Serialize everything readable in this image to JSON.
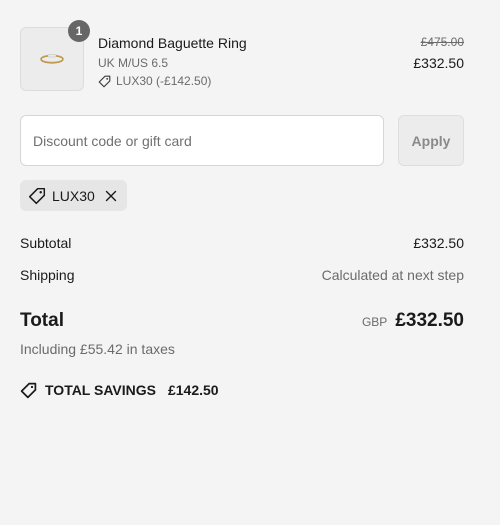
{
  "line_item": {
    "quantity": "1",
    "title": "Diamond Baguette Ring",
    "variant": "UK M/US 6.5",
    "discount": "LUX30 (-£142.50)",
    "original_price": "£475.00",
    "price": "£332.50",
    "thumbnail_icon": "ring-icon"
  },
  "discount": {
    "placeholder": "Discount code or gift card",
    "value": "",
    "apply_label": "Apply",
    "applied_code": "LUX30"
  },
  "summary": {
    "subtotal_label": "Subtotal",
    "subtotal_value": "£332.50",
    "shipping_label": "Shipping",
    "shipping_value": "Calculated at next step",
    "total_label": "Total",
    "currency": "GBP",
    "total_value": "£332.50",
    "tax_note": "Including £55.42 in taxes",
    "savings_label": "TOTAL SAVINGS",
    "savings_value": "£142.50"
  },
  "colors": {
    "background": "#f4f4f4",
    "badge": "#666666",
    "muted_text": "#6b6b6b"
  }
}
